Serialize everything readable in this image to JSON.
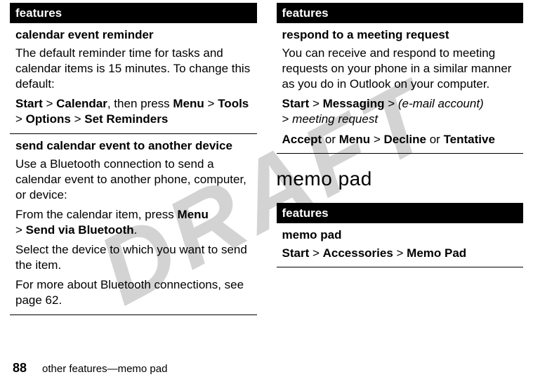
{
  "watermark": "DRAFT",
  "leftColumn": {
    "header": "features",
    "rows": [
      {
        "title": "calendar event reminder",
        "body1": "The default reminder time for tasks and calendar items is 15 minutes. To change this default:",
        "path_prefix1": "Start",
        "path_sep1": " > ",
        "path_step2": "Calendar",
        "path_mid": ", then press ",
        "path_step3": "Menu",
        "path_sep2": " > ",
        "path_step4": "Tools",
        "path_sep3": " > ",
        "path_step5": "Options",
        "path_sep4": " > ",
        "path_step6": "Set Reminders"
      },
      {
        "title": "send calendar event to another device",
        "body1": "Use a Bluetooth connection to send a calendar event to another phone, computer, or device:",
        "line2_pre": "From the calendar item, press ",
        "line2_b1": "Menu",
        "line2_sep": " > ",
        "line2_b2": "Send via Bluetooth",
        "line2_end": ".",
        "body3": "Select the device to which you want to send the item.",
        "body4": "For more about Bluetooth connections, see page 62."
      }
    ]
  },
  "rightTop": {
    "header": "features",
    "rows": [
      {
        "title": "respond to a meeting request",
        "body1": "You can receive and respond to meeting requests on your phone in a similar manner as you do in Outlook on your computer.",
        "p2_b1": "Start",
        "p2_sep1": " > ",
        "p2_b2": "Messaging",
        "p2_sep2": " > ",
        "p2_i1": "(e-mail account)",
        "p2_sep3": " > ",
        "p2_i2": "meeting request",
        "p3_b1": "Accept",
        "p3_t1": " or ",
        "p3_b2": "Menu",
        "p3_sep": " > ",
        "p3_b3": "Decline",
        "p3_t2": " or ",
        "p3_b4": "Tentative"
      }
    ]
  },
  "sectionHeading": "memo pad",
  "rightBottom": {
    "header": "features",
    "rows": [
      {
        "title": "memo pad",
        "p_b1": "Start",
        "p_sep1": " > ",
        "p_b2": "Accessories",
        "p_sep2": " > ",
        "p_b3": "Memo Pad"
      }
    ]
  },
  "footer": {
    "pageNumber": "88",
    "crumb": "other features—memo pad"
  }
}
